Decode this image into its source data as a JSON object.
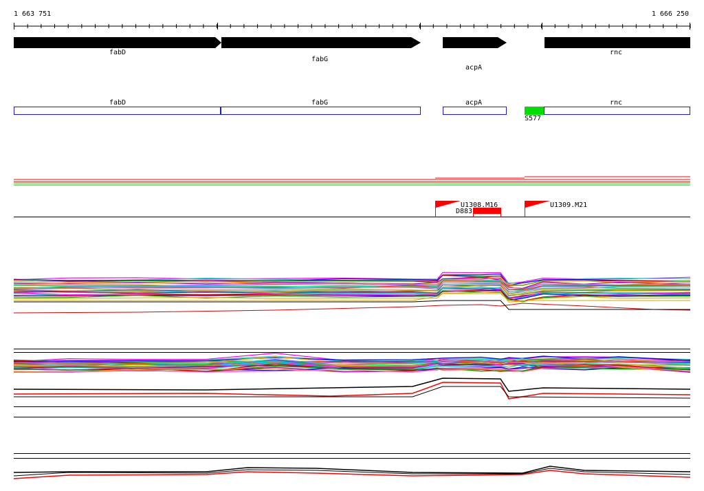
{
  "coords": {
    "start": "1 663 751",
    "end": "1 666 250"
  },
  "colors": {
    "gene": "#000000",
    "cds_outline": "#1a1acc",
    "promoter": "#00dd00",
    "feature_red": "#ff0000",
    "green": "#00bb00"
  },
  "genes": [
    {
      "label": "fabD"
    },
    {
      "label": "fabG"
    },
    {
      "label": "acpA"
    },
    {
      "label": "rnc"
    }
  ],
  "annotations": [
    {
      "label": "fabD"
    },
    {
      "label": "fabG"
    },
    {
      "label": "acpA"
    },
    {
      "label": "rnc"
    }
  ],
  "promoter": {
    "label": "S577"
  },
  "features": [
    {
      "label": "U1308.M16"
    },
    {
      "label": "U1309.M21"
    },
    {
      "label": "D883"
    }
  ]
}
